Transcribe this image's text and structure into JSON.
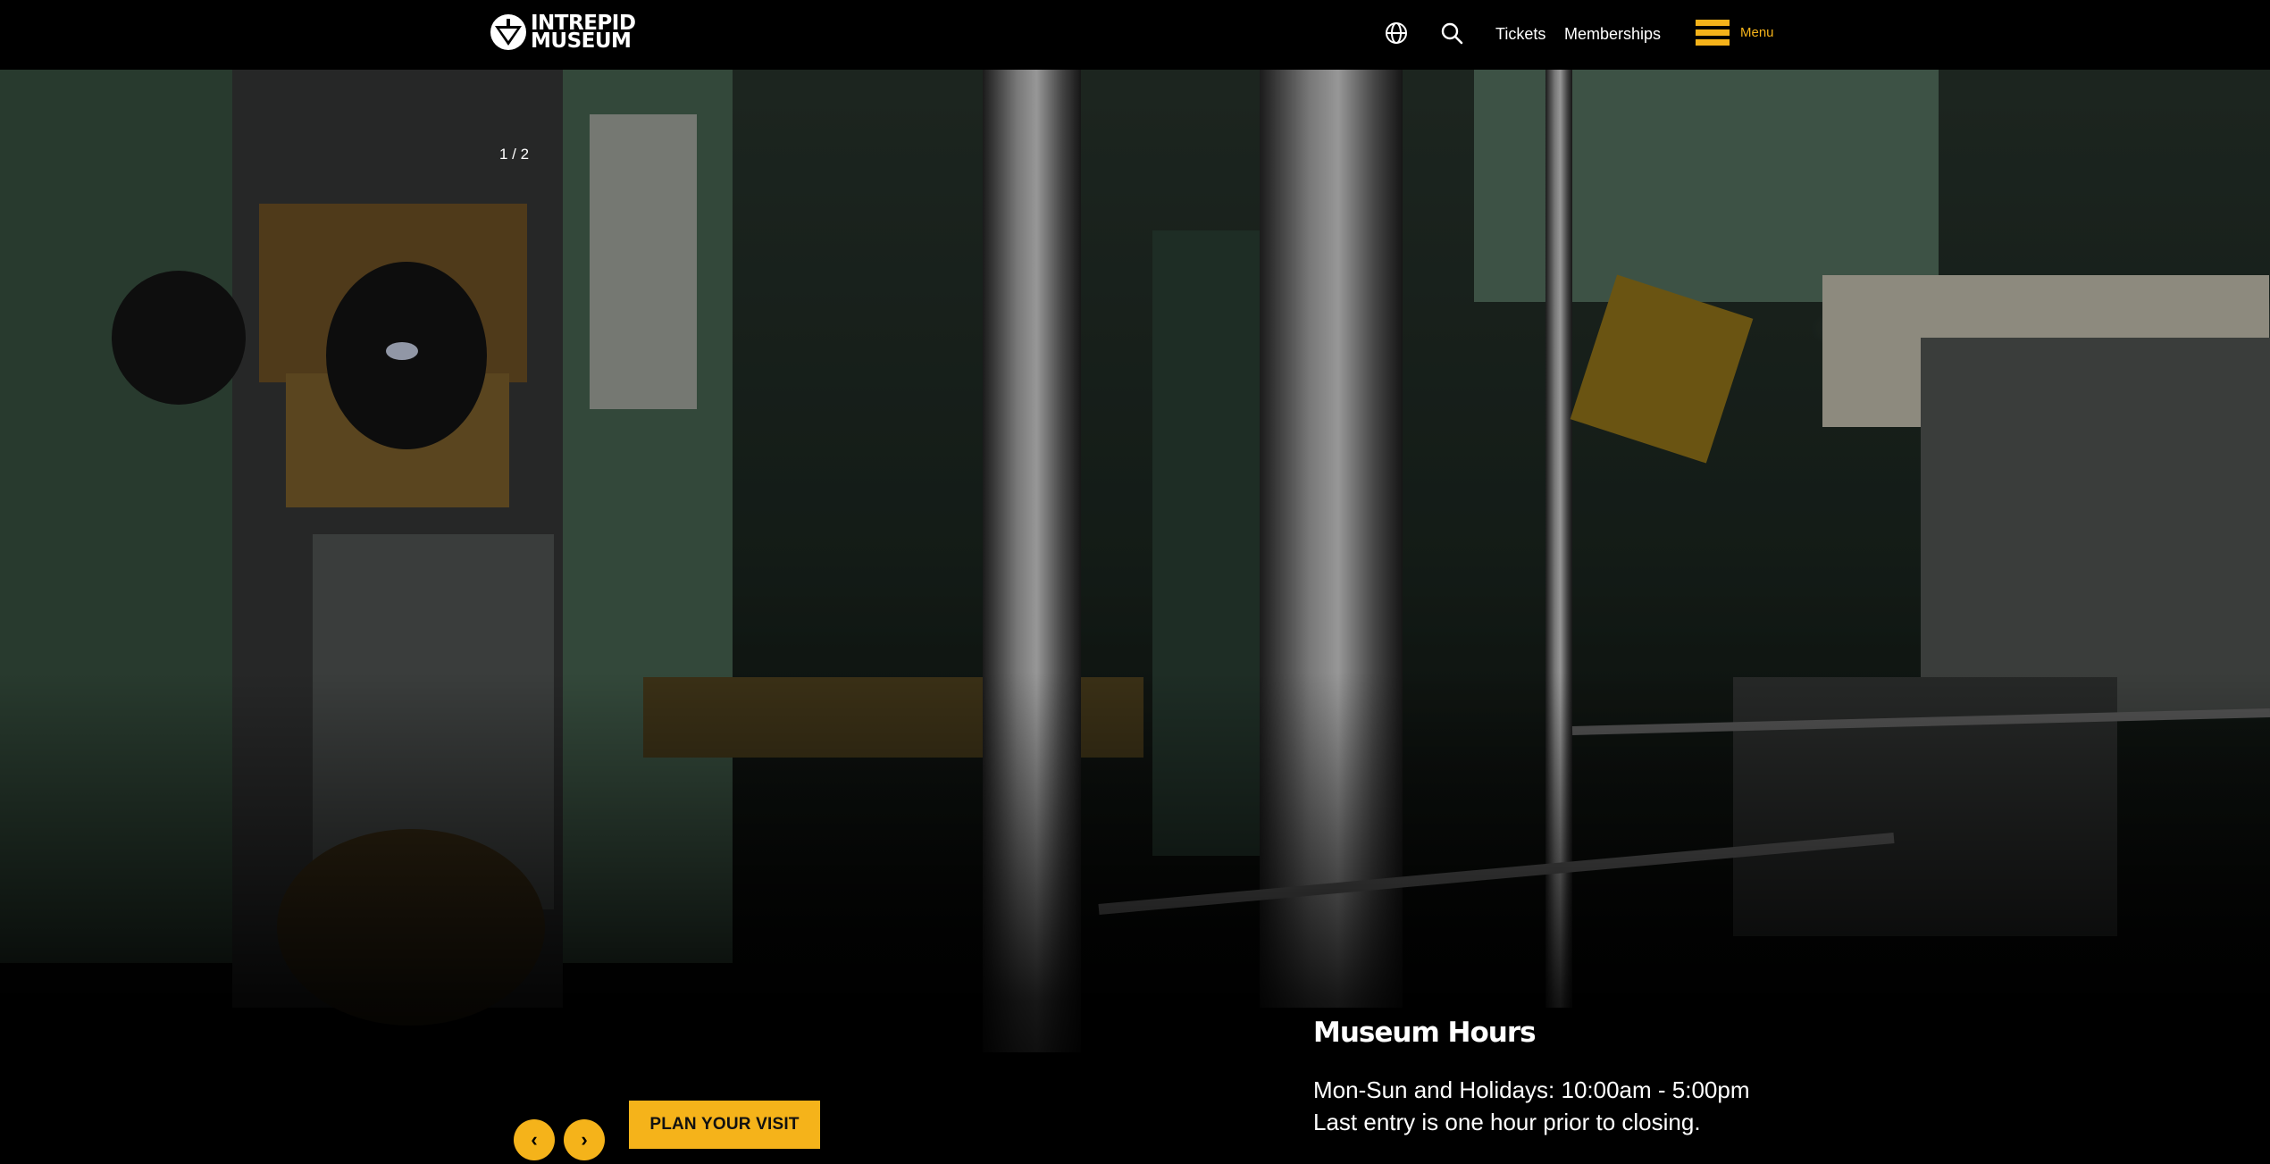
{
  "header": {
    "logo": {
      "line1": "INTREPID",
      "line2": "MUSEUM"
    },
    "nav": {
      "globe_icon": "globe-icon",
      "search_icon": "search-icon",
      "tickets": "Tickets",
      "memberships": "Memberships",
      "menu_icon": "hamburger-icon",
      "menu": "Menu"
    }
  },
  "hero": {
    "slide_counter": "1 / 2",
    "prev_arrow": "‹",
    "next_arrow": "›",
    "cta": "PLAN YOUR VISIT",
    "hours": {
      "title": "Museum Hours",
      "line1": "Mon-Sun and Holidays: 10:00am - 5:00pm",
      "line2": "Last entry is one hour prior to closing."
    }
  },
  "colors": {
    "accent": "#f5b31a",
    "header_bg": "#000000",
    "text": "#ffffff"
  }
}
